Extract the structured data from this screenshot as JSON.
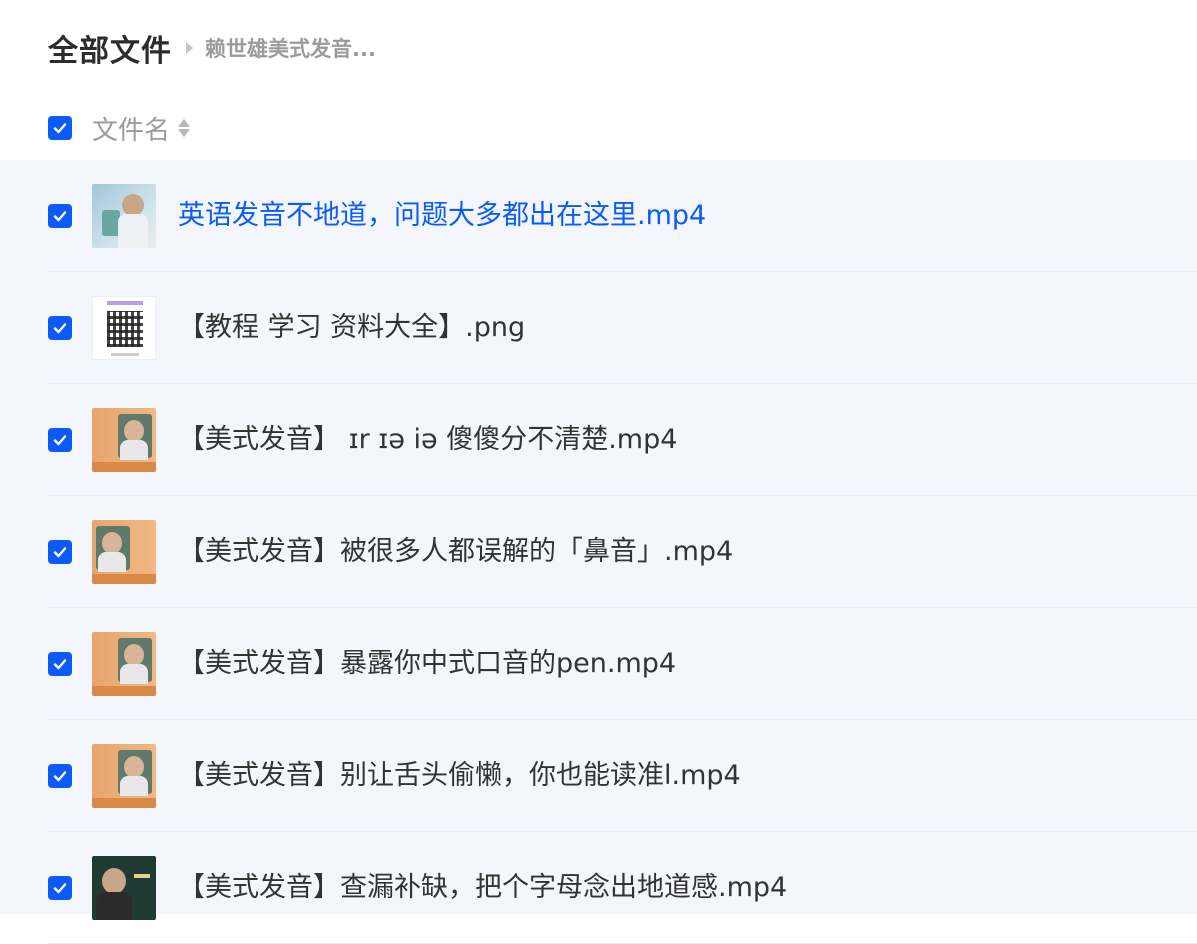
{
  "breadcrumb": {
    "root": "全部文件",
    "current": "赖世雄美式发音..."
  },
  "header": {
    "column_label": "文件名",
    "select_all_checked": true
  },
  "colors": {
    "accent": "#0a5bf7",
    "list_background": "#f4f6fd"
  },
  "files": [
    {
      "name": "英语发音不地道，问题大多都出在这里.mp4",
      "thumbnail": "video-thumbnail",
      "checked": true,
      "highlighted": true
    },
    {
      "name": "【教程 学习 资料大全】.png",
      "thumbnail": "qr-code-thumbnail",
      "checked": true,
      "highlighted": false
    },
    {
      "name": "【美式发音】 ɪr ɪə iə 傻傻分不清楚.mp4",
      "thumbnail": "video-thumbnail",
      "checked": true,
      "highlighted": false
    },
    {
      "name": "【美式发音】被很多人都误解的「鼻音」.mp4",
      "thumbnail": "video-thumbnail",
      "checked": true,
      "highlighted": false
    },
    {
      "name": "【美式发音】暴露你中式口音的pen.mp4",
      "thumbnail": "video-thumbnail",
      "checked": true,
      "highlighted": false
    },
    {
      "name": "【美式发音】别让舌头偷懒，你也能读准l.mp4",
      "thumbnail": "video-thumbnail",
      "checked": true,
      "highlighted": false
    },
    {
      "name": "【美式发音】查漏补缺，把个字母念出地道感.mp4",
      "thumbnail": "video-thumbnail",
      "checked": true,
      "highlighted": false
    }
  ]
}
